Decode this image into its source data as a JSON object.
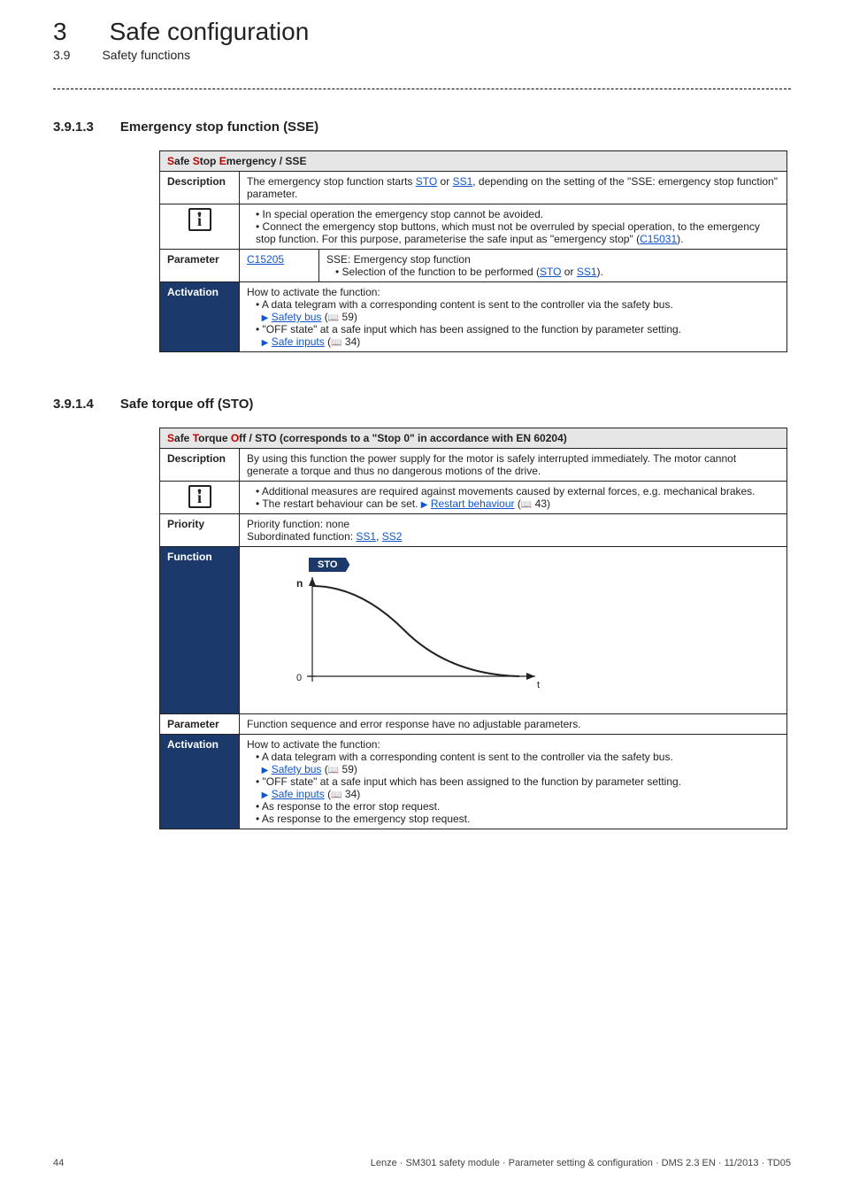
{
  "chapter": {
    "num": "3",
    "title": "Safe configuration"
  },
  "section": {
    "num": "3.9",
    "title": "Safety functions"
  },
  "sse": {
    "num": "3.9.1.3",
    "title": "Emergency stop function (SSE)",
    "header_pre": "S",
    "header_mid1": "afe ",
    "header_s2": "S",
    "header_mid2": "top ",
    "header_e": "E",
    "header_post": "mergency / SSE",
    "desc_label": "Description",
    "desc_pre": "The emergency stop function starts ",
    "link_sto": "STO",
    "desc_or": " or ",
    "link_ss1": "SS1",
    "desc_post": ", depending on the setting of the \"SSE: emergency stop function\" parameter.",
    "info_b1": "In special operation the emergency stop cannot be avoided.",
    "info_b2_pre": "Connect the emergency stop buttons, which must not be overruled by special operation, to the emergency stop function. For this purpose, parameterise the safe input as \"emergency stop\" (",
    "info_b2_link": "C15031",
    "info_b2_post": ").",
    "param_label": "Parameter",
    "param_link": "C15205",
    "param_title": "SSE: Emergency stop function",
    "param_bullet_pre": "Selection of the function to be performed (",
    "param_bullet_sto": "STO",
    "param_bullet_or": " or ",
    "param_bullet_ss1": "SS1",
    "param_bullet_post": ").",
    "act_label": "Activation",
    "act_intro": "How to activate the function:",
    "act_b1": "A data telegram with a corresponding content is sent to the controller via the safety bus.",
    "act_b1_link": "Safety bus",
    "act_b1_page": " 59)",
    "act_b2": "\"OFF state\" at a safe input which has been assigned to the function by parameter setting.",
    "act_b2_link": "Safe inputs",
    "act_b2_page": " 34)"
  },
  "sto": {
    "num": "3.9.1.4",
    "title": "Safe torque off (STO)",
    "header_s1": "S",
    "header_mid1": "afe ",
    "header_t": "T",
    "header_mid2": "orque ",
    "header_o": "O",
    "header_post": "ff / STO (corresponds to a \"Stop 0\" in accordance with EN 60204)",
    "desc_label": "Description",
    "desc": "By using this function the power supply for the motor is safely interrupted immediately. The motor cannot generate a torque and thus no dangerous motions of the drive.",
    "info_b1": "Additional measures are required against movements caused by external forces, e.g. mechanical brakes.",
    "info_b2_pre": "The restart behaviour can be set.   ",
    "info_b2_link": "Restart behaviour",
    "info_b2_page": " 43)",
    "prio_label": "Priority",
    "prio_line1": "Priority function: none",
    "prio_line2_pre": "Subordinated function: ",
    "prio_ss1": "SS1",
    "prio_sep": ", ",
    "prio_ss2": "SS2",
    "func_label": "Function",
    "graph_label": "STO",
    "axis_n": "n",
    "axis_0": "0",
    "axis_t": "t",
    "param_label": "Parameter",
    "param_text": "Function sequence and error response have no adjustable parameters.",
    "act_label": "Activation",
    "act_intro": "How to activate the function:",
    "act_b1": "A data telegram with a corresponding content is sent to the controller via the safety bus.",
    "act_b1_link": "Safety bus",
    "act_b1_page": " 59)",
    "act_b2": "\"OFF state\" at a safe input which has been assigned to the function by parameter setting.",
    "act_b2_link": "Safe inputs",
    "act_b2_page": " 34)",
    "act_b3": "As response to the error stop request.",
    "act_b4": "As response to the emergency stop request."
  },
  "footer": {
    "page": "44",
    "info": "Lenze · SM301 safety module · Parameter setting & configuration · DMS 2.3 EN · 11/2013 · TD05"
  }
}
